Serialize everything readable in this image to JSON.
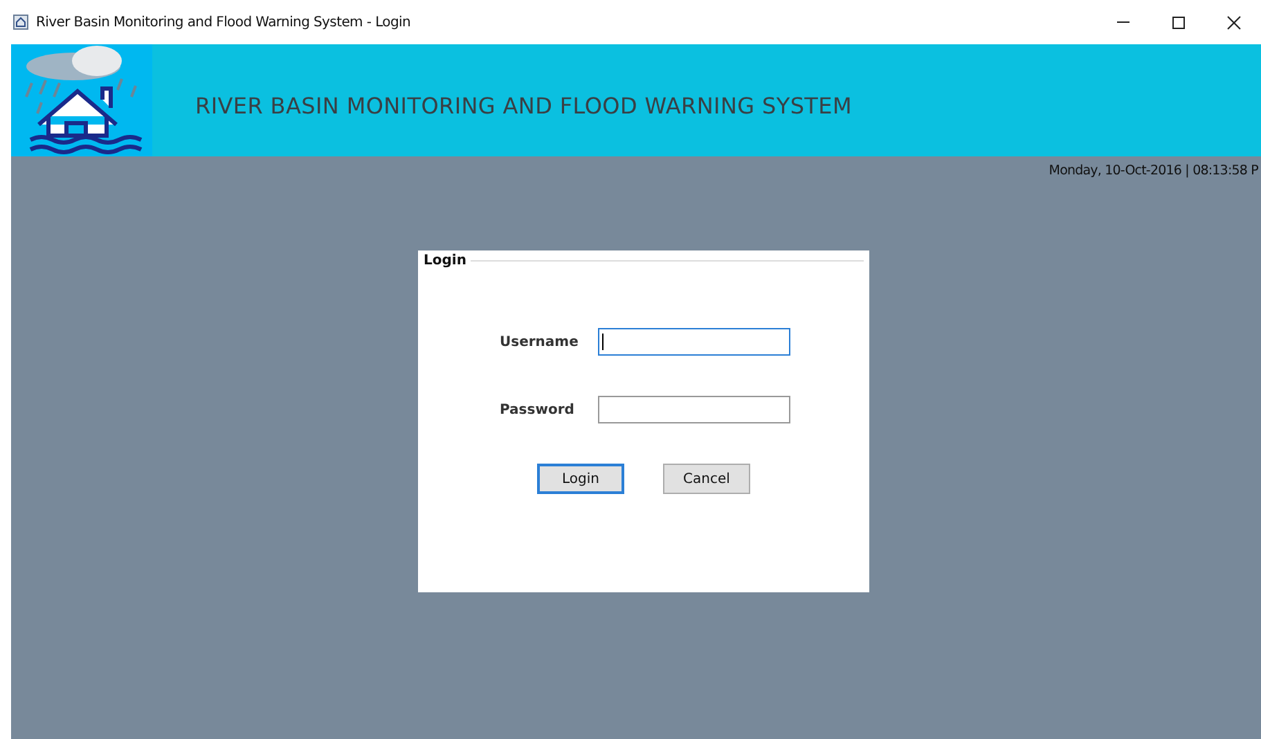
{
  "window": {
    "title": "River Basin Monitoring and Flood Warning System - Login",
    "controls": [
      {
        "kind": "minimize"
      },
      {
        "kind": "maximize"
      },
      {
        "kind": "close"
      }
    ]
  },
  "banner": {
    "title": "RIVER BASIN MONITORING AND FLOOD WARNING SYSTEM"
  },
  "datetime": "Monday, 10-Oct-2016 | 08:13:58 P",
  "login": {
    "legend": "Login",
    "fields": [
      {
        "label": "Username",
        "focused": true
      },
      {
        "label": "Password",
        "focused": false
      }
    ],
    "buttons": [
      {
        "label": "Login",
        "default": true
      },
      {
        "label": "Cancel",
        "default": false
      }
    ]
  }
}
